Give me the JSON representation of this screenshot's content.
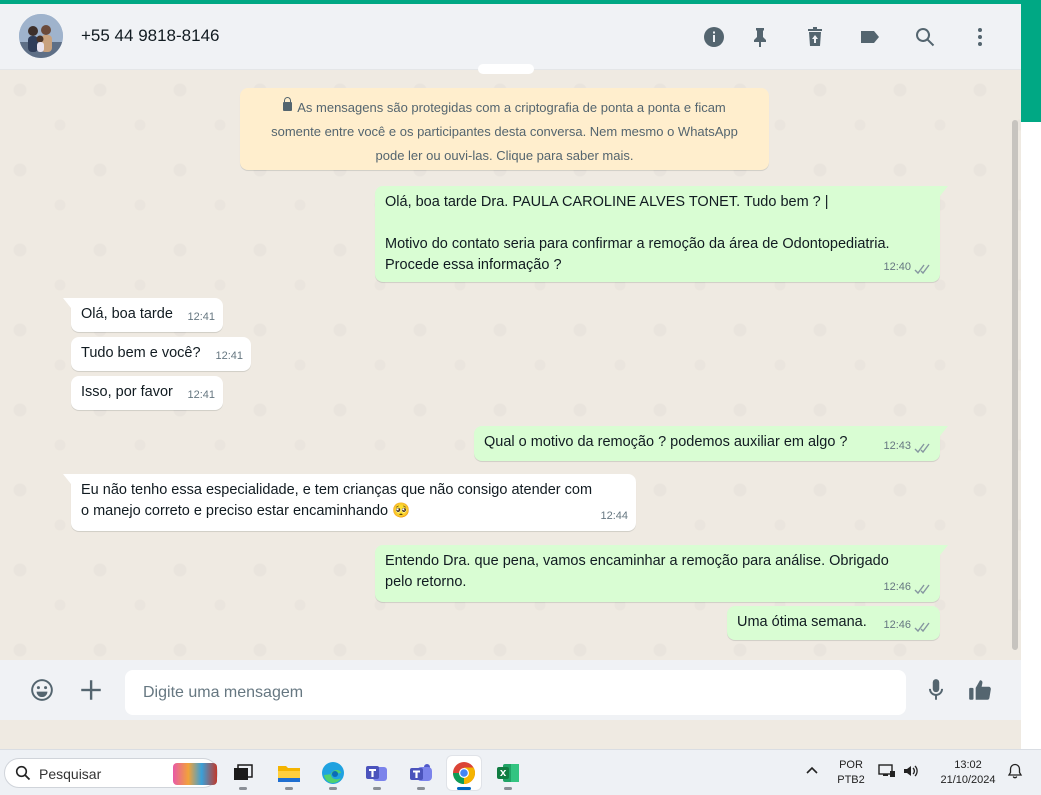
{
  "header": {
    "contact_name": "+55 44 9818-8146",
    "icons": [
      "info-icon",
      "pin-icon",
      "delete-icon",
      "label-icon",
      "search-icon",
      "menu-icon"
    ]
  },
  "notice": {
    "line1": "As mensagens são protegidas com a criptografia de ponta a ponta e ficam",
    "line2": "somente entre você e os participantes desta conversa. Nem mesmo o WhatsApp",
    "line3": "pode ler ou ouvi-las. Clique para saber mais."
  },
  "messages": [
    {
      "dir": "out",
      "lines": [
        "Olá, boa tarde Dra. PAULA CAROLINE ALVES TONET. Tudo bem ? |",
        "",
        "Motivo do contato seria para confirmar a remoção da área de Odontopediatria.",
        "Procede essa informação ?"
      ],
      "time": "12:40",
      "status": "read"
    },
    {
      "dir": "in",
      "lines": [
        "Olá, boa tarde"
      ],
      "time": "12:41"
    },
    {
      "dir": "in",
      "lines": [
        "Tudo bem e você?"
      ],
      "time": "12:41"
    },
    {
      "dir": "in",
      "lines": [
        "Isso, por favor"
      ],
      "time": "12:41"
    },
    {
      "dir": "out",
      "lines": [
        "Qual o motivo da remoção ? podemos auxiliar em algo ?"
      ],
      "time": "12:43",
      "status": "read"
    },
    {
      "dir": "in",
      "lines": [
        "Eu não tenho essa especialidade, e tem crianças que não consigo atender com",
        "o manejo correto e preciso estar encaminhando 🥺"
      ],
      "time": "12:44"
    },
    {
      "dir": "out",
      "lines": [
        "Entendo Dra. que pena, vamos encaminhar a remoção para análise. Obrigado",
        "pelo retorno."
      ],
      "time": "12:46",
      "status": "read"
    },
    {
      "dir": "out",
      "lines": [
        "Uma ótima semana."
      ],
      "time": "12:46",
      "status": "read"
    }
  ],
  "composer": {
    "placeholder": "Digite uma mensagem",
    "icons": [
      "emoji-icon",
      "attach-plus-icon",
      "microphone-icon",
      "thumbs-up-icon"
    ]
  },
  "taskbar": {
    "search_label": "Pesquisar",
    "apps": [
      "task-view",
      "file-explorer",
      "edge",
      "teams",
      "teams-classic",
      "chrome",
      "excel"
    ],
    "active_app": "chrome",
    "language_line1": "POR",
    "language_line2": "PTB2",
    "time": "13:02",
    "date": "21/10/2024"
  },
  "colors": {
    "accent": "#00a884",
    "chat_bg": "#efeae2",
    "outgoing_bubble": "#d9fdd3",
    "incoming_bubble": "#ffffff",
    "notice_bg": "#ffeecd",
    "header_bg": "#f0f2f5"
  }
}
